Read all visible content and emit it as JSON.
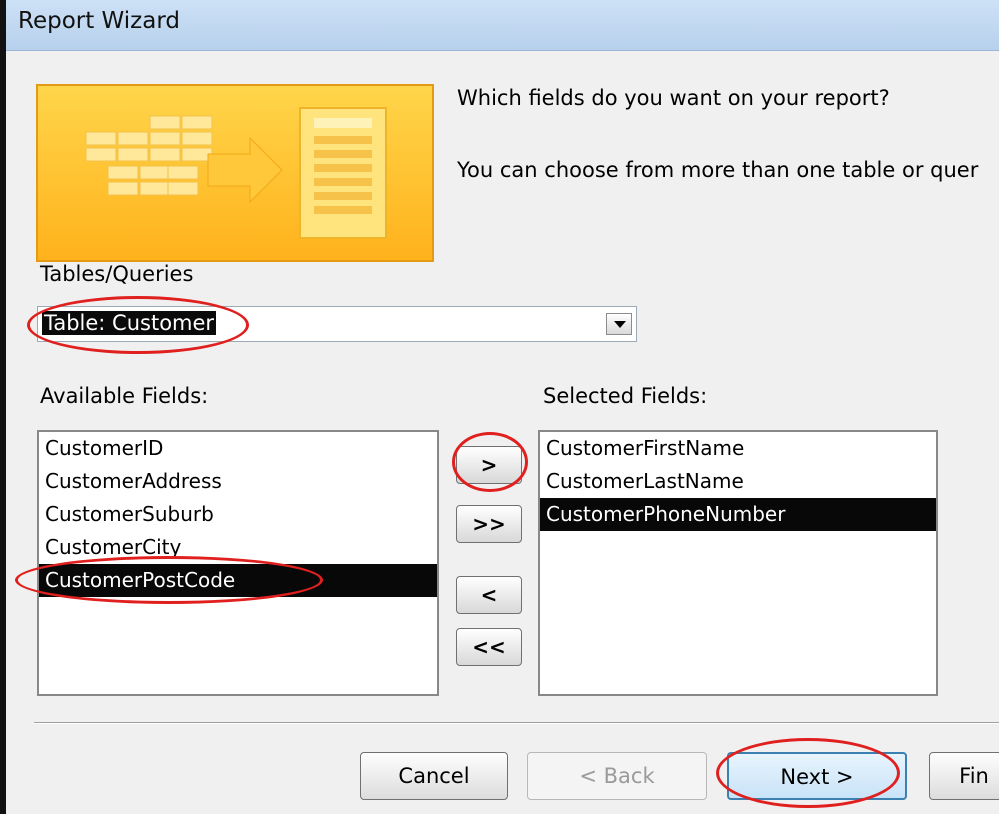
{
  "window": {
    "title": "Report Wizard"
  },
  "prompt": {
    "question": "Which fields do you want on your report?",
    "hint": "You can choose from more than one table or quer"
  },
  "tables_queries": {
    "label": "Tables/Queries",
    "selected": "Table: Customer"
  },
  "available": {
    "label": "Available Fields:",
    "items": [
      "CustomerID",
      "CustomerAddress",
      "CustomerSuburb",
      "CustomerCity",
      "CustomerPostCode"
    ],
    "selected_index": 4
  },
  "selected": {
    "label": "Selected Fields:",
    "items": [
      "CustomerFirstName",
      "CustomerLastName",
      "CustomerPhoneNumber"
    ],
    "selected_index": 2
  },
  "move_buttons": {
    "add_one": ">",
    "add_all": ">>",
    "remove_one": "<",
    "remove_all": "<<"
  },
  "buttons": {
    "cancel": "Cancel",
    "back": "< Back",
    "next": "Next >",
    "finish": "Fin"
  },
  "colors": {
    "annotation": "#e0201e",
    "selection": "#080808"
  }
}
